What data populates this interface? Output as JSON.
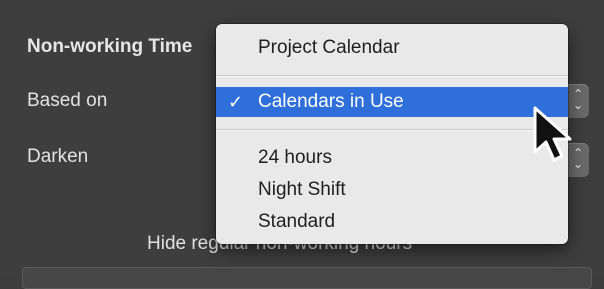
{
  "section": {
    "title": "Non-working Time"
  },
  "rows": {
    "based_on_label": "Based on",
    "darken_label": "Darken"
  },
  "hide_text": "Hide regular non-working hours",
  "menu": {
    "items": [
      {
        "label": "Project Calendar",
        "selected": false
      },
      {
        "label": "Calendars in Use",
        "selected": true
      },
      {
        "label": "24 hours",
        "selected": false
      },
      {
        "label": "Night Shift",
        "selected": false
      },
      {
        "label": "Standard",
        "selected": false
      }
    ],
    "checkmark": "✓",
    "selected_color": "#2f6fda"
  },
  "icons": {
    "stepper": "up-down-arrows-icon",
    "cursor": "arrow-pointer-icon"
  }
}
